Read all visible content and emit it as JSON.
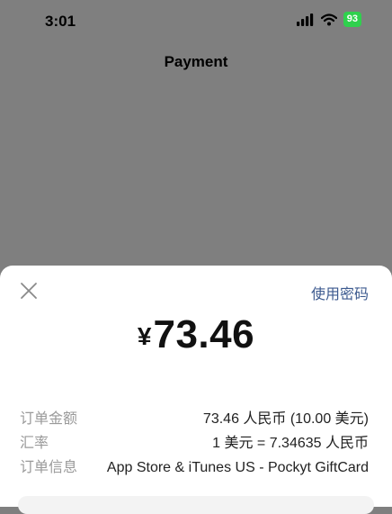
{
  "status_bar": {
    "time": "3:01",
    "battery": "93"
  },
  "nav": {
    "title": "Payment"
  },
  "sheet": {
    "use_password": "使用密码",
    "currency": "¥",
    "amount": "73.46",
    "rows": [
      {
        "label": "订单金额",
        "value": "73.46 人民币 (10.00 美元)"
      },
      {
        "label": "汇率",
        "value": "1 美元 = 7.34635 人民币"
      },
      {
        "label": "订单信息",
        "value": "App Store & iTunes US - Pockyt GiftCard"
      }
    ]
  },
  "icons": {
    "close": "close-icon",
    "signal": "cellular-signal-icon",
    "wifi": "wifi-icon",
    "battery": "battery-icon"
  },
  "colors": {
    "overlay": "#7f7f7f",
    "link": "#3c5a8f",
    "battery": "#2fd14d"
  }
}
